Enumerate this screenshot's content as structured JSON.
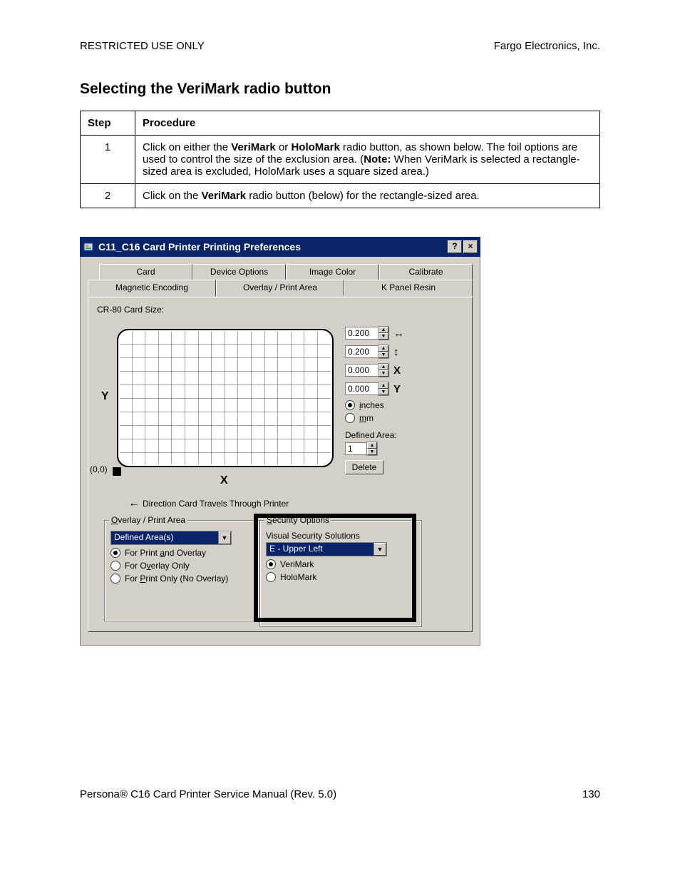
{
  "header": {
    "restricted": "RESTRICTED USE ONLY",
    "company": "Fargo Electronics, Inc."
  },
  "title": "Selecting the VeriMark radio button",
  "table": {
    "head": {
      "step": "Step",
      "proc": "Procedure"
    },
    "rows": [
      {
        "step": "1",
        "proc_a": "Click on either the ",
        "proc_b1": "VeriMark",
        "proc_c": " or ",
        "proc_b2": "HoloMark",
        "proc_d": " radio button, as shown below. The foil options are used to control the size of the exclusion area. (",
        "proc_note": "Note:",
        "proc_e": "  When VeriMark is selected a rectangle-sized area is excluded, HoloMark uses a square sized area.)"
      },
      {
        "step": "2",
        "proc_a": "Click on the ",
        "proc_b1": "VeriMark",
        "proc_c": " radio button (below) for the rectangle-sized area."
      }
    ]
  },
  "dialog": {
    "title": "C11_C16 Card Printer Printing Preferences",
    "tabs_back": [
      "Card",
      "Device Options",
      "Image Color",
      "Calibrate"
    ],
    "tabs_front": [
      "Magnetic Encoding",
      "Overlay / Print Area",
      "K Panel Resin"
    ],
    "card_size_label": "CR-80 Card Size:",
    "axes": {
      "y": "Y",
      "x": "X",
      "origin": "(0,0)"
    },
    "direction": "Direction Card Travels Through Printer",
    "spinners": [
      {
        "value": "0.200",
        "sym": "↔"
      },
      {
        "value": "0.200",
        "sym": "↕"
      },
      {
        "value": "0.000",
        "sym": "X"
      },
      {
        "value": "0.000",
        "sym": "Y"
      }
    ],
    "unit_radios": {
      "inches": "inches",
      "mm": "mm"
    },
    "defined_area_label": "Defined Area:",
    "defined_area_value": "1",
    "delete_btn": "Delete",
    "overlay_group": {
      "title": "Overlay / Print Area",
      "combo": "Defined Area(s)",
      "r1": "For Print and Overlay",
      "r2": "For Overlay Only",
      "r3": "For Print Only (No Overlay)"
    },
    "security_group": {
      "title": "Security Options",
      "sub": "Visual Security Solutions",
      "combo": "E - Upper Left",
      "r1": "VeriMark",
      "r2": "HoloMark"
    }
  },
  "footer": {
    "manual": "Persona® C16 Card Printer Service Manual (Rev. 5.0)",
    "page": "130"
  }
}
